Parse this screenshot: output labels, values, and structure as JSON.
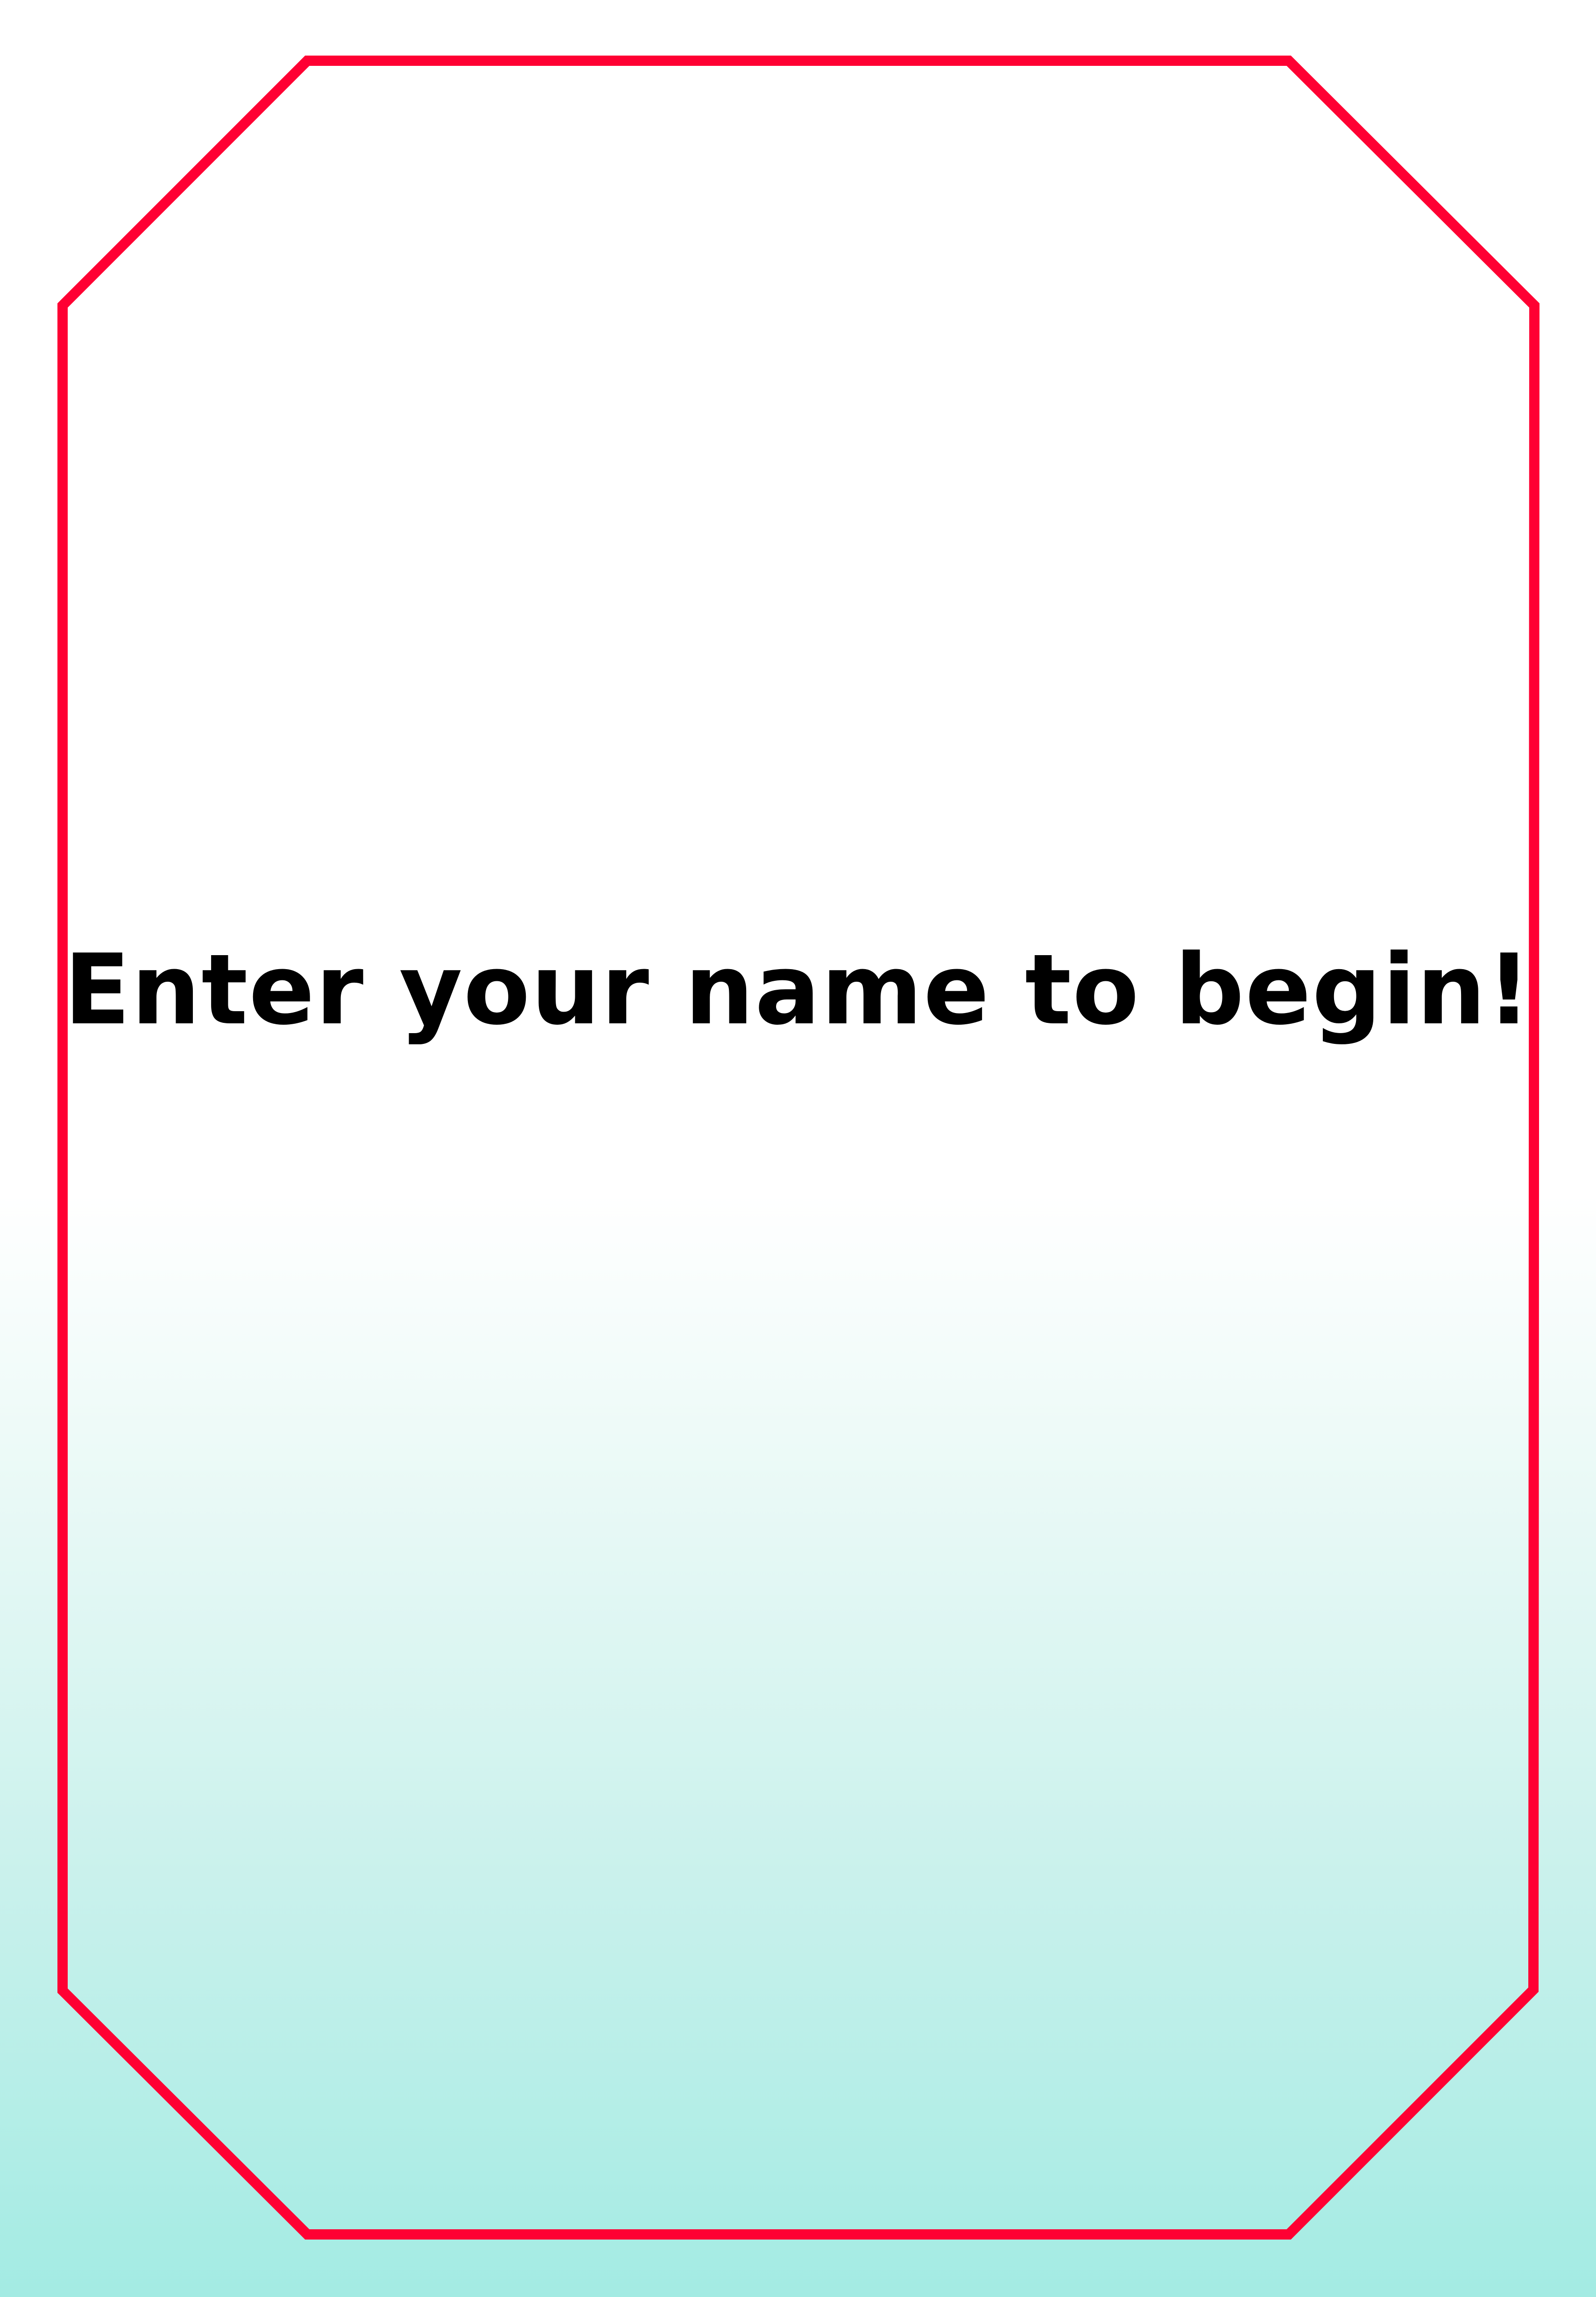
{
  "screen": {
    "prompt_text": "Enter your name to begin!"
  },
  "colors": {
    "frame_border": "#ff0033",
    "text": "#000000",
    "background_top": "#ffffff",
    "background_bottom": "#a3ebe3"
  }
}
